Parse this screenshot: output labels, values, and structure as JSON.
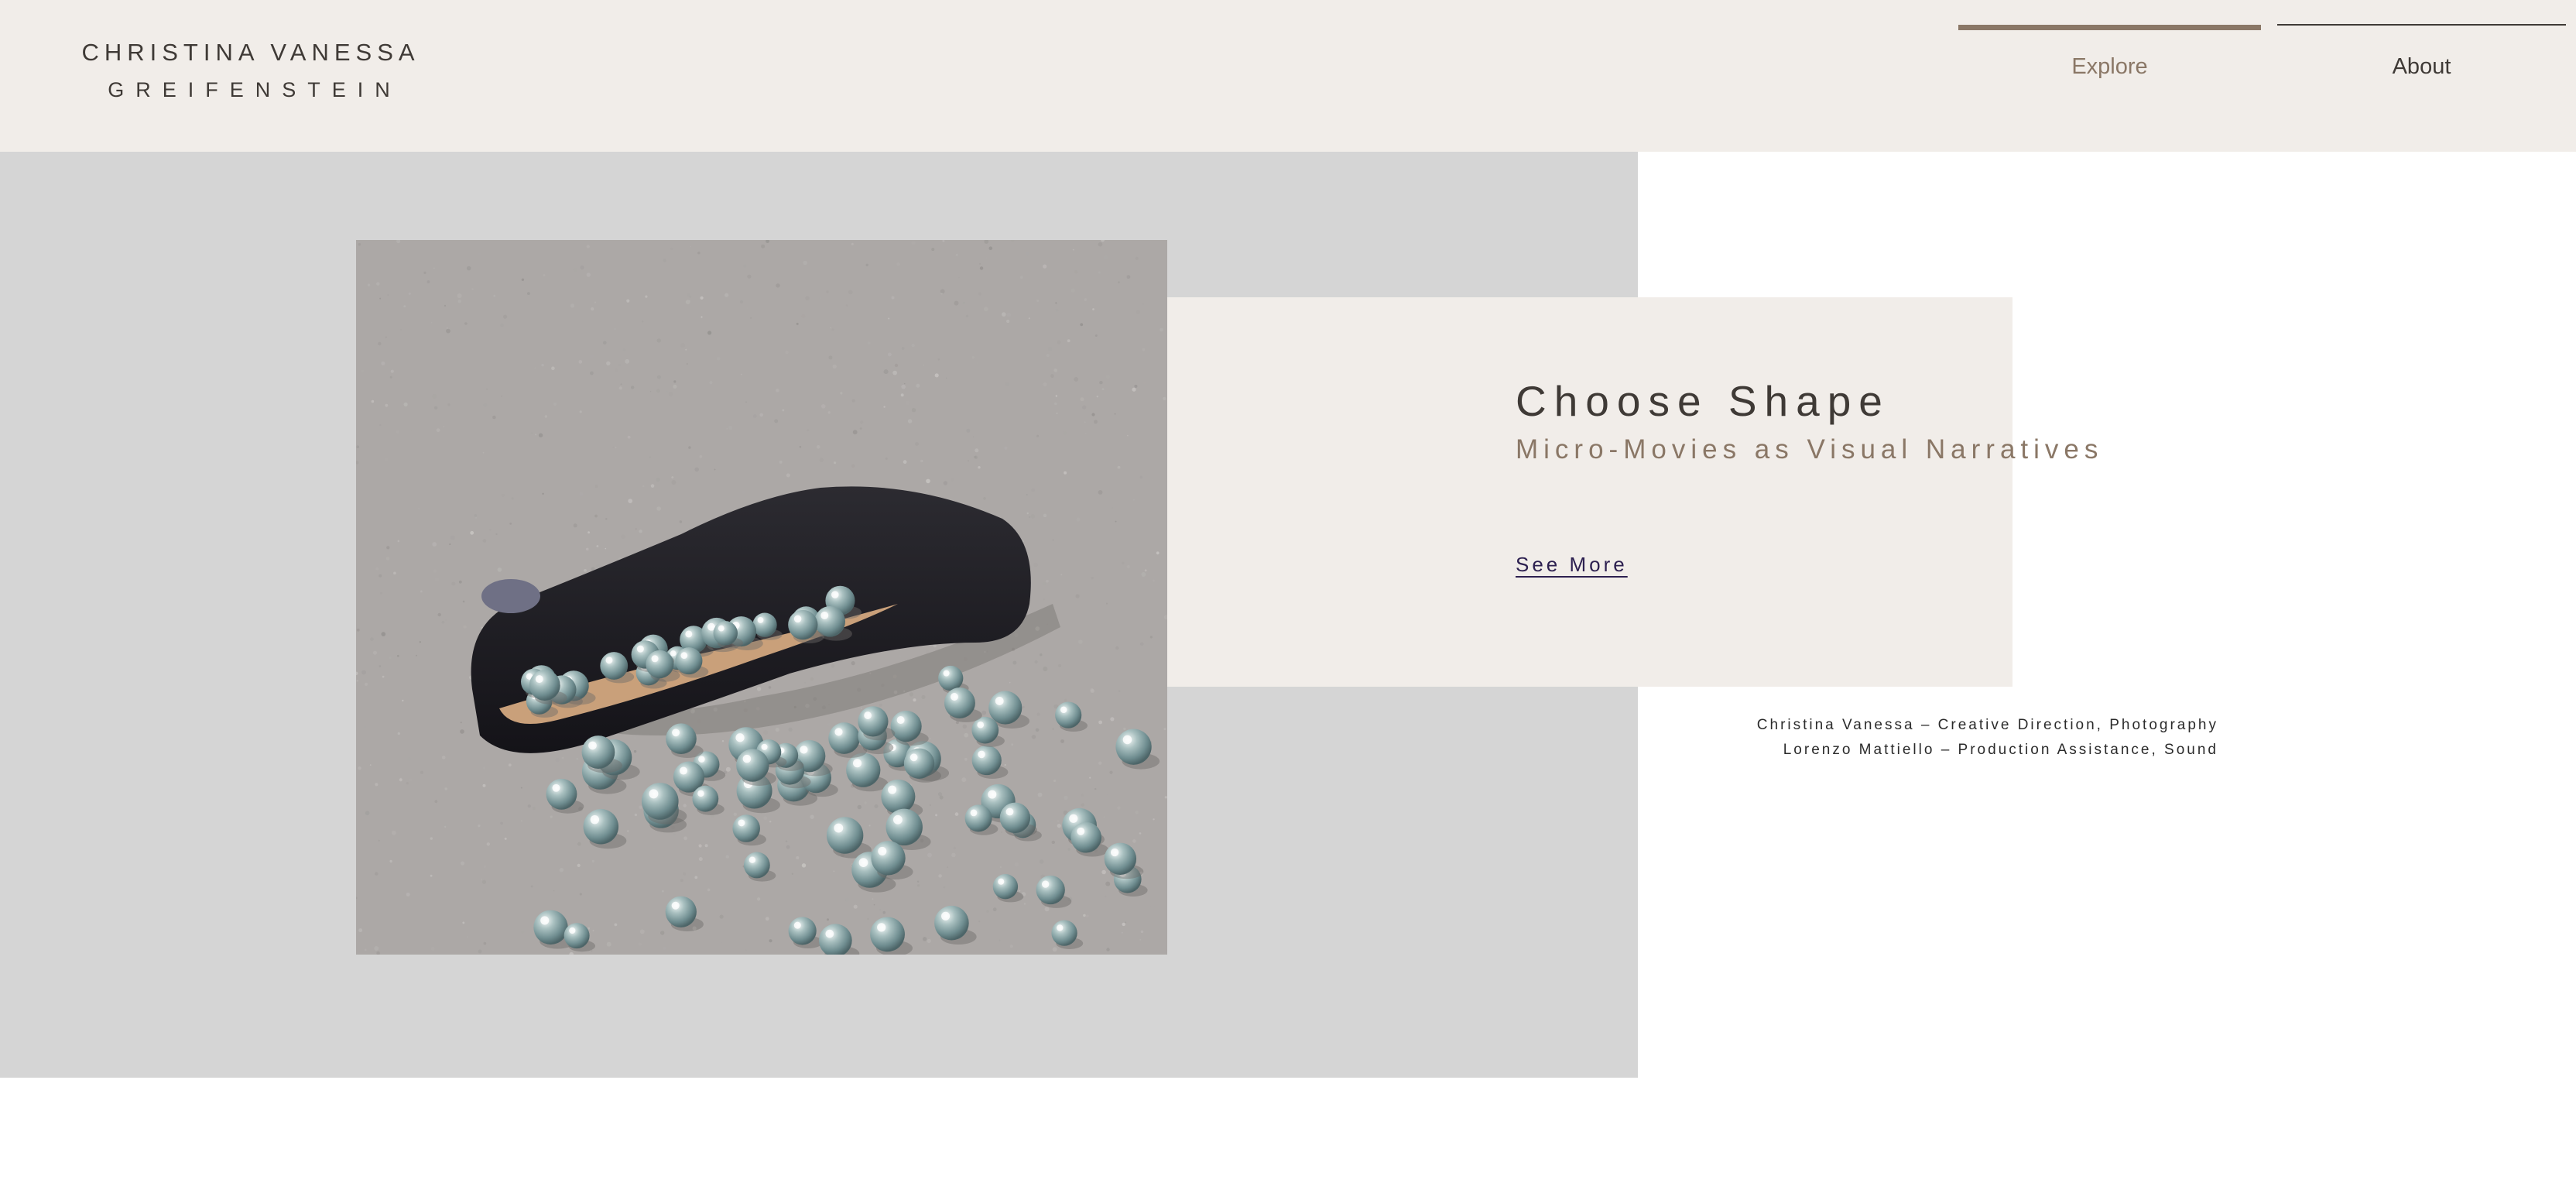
{
  "site": {
    "logo_line1": "CHRISTINA VANESSA",
    "logo_line2": "GREIFENSTEIN"
  },
  "nav": {
    "items": [
      {
        "label": "Explore",
        "active": true
      },
      {
        "label": "About",
        "active": false
      }
    ]
  },
  "project": {
    "title": "Choose Shape",
    "subtitle": "Micro-Movies as Visual Narratives",
    "cta_label": "See More",
    "credits": [
      "Christina Vanessa – Creative Direction, Photography",
      "Lorenzo Mattiello – Production Assistance, Sound"
    ],
    "image_subject": "black suede shoe with scattered glass marbles on concrete"
  },
  "colors": {
    "header_bg": "#f1ede9",
    "panel_gray": "#d5d5d5",
    "accent_brown": "#8a7766",
    "text_dark": "#3f3a36",
    "link_purple": "#2d2050"
  }
}
